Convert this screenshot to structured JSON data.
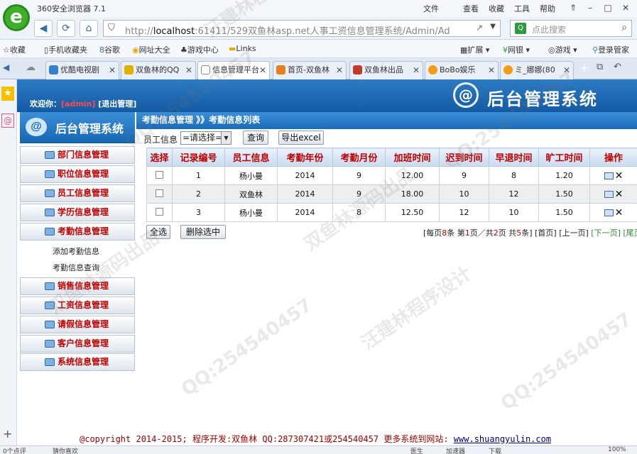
{
  "browser": {
    "title": "360安全浏览器 7.1",
    "menu": [
      "文件",
      "查看",
      "收藏",
      "工具",
      "帮助"
    ],
    "url_host": "localhost",
    "url_rest": ":61411/529双鱼林asp.net人事工资信息管理系统/Admin/Ad",
    "search_placeholder": "点此搜索"
  },
  "favorites": [
    "收藏",
    "手机收藏夹",
    "谷歌",
    "网址大全",
    "游戏中心",
    "Links",
    "扩展",
    "网银",
    "游戏",
    "登录管家"
  ],
  "tabs": [
    {
      "label": "优酷电视剧"
    },
    {
      "label": "双鱼林的QQ"
    },
    {
      "label": "信息管理平台"
    },
    {
      "label": "首页-双鱼林"
    },
    {
      "label": "双鱼林出品"
    },
    {
      "label": "BoBo娱乐"
    },
    {
      "label": "ミ_娜娜(80"
    }
  ],
  "header": {
    "welcome_label": "欢迎你：",
    "user": "[admin]",
    "logout": "[退出管理]",
    "logo": "@",
    "title": "后台管理系统"
  },
  "sidebar": {
    "title": "后台管理系统",
    "items": [
      {
        "label": "部门信息管理"
      },
      {
        "label": "职位信息管理"
      },
      {
        "label": "员工信息管理"
      },
      {
        "label": "学历信息管理"
      },
      {
        "label": "考勤信息管理"
      }
    ],
    "subitems": [
      {
        "label": "添加考勤信息"
      },
      {
        "label": "考勤信息查询"
      }
    ],
    "items2": [
      {
        "label": "销售信息管理"
      },
      {
        "label": "工资信息管理"
      },
      {
        "label": "请假信息管理"
      },
      {
        "label": "客户信息管理"
      },
      {
        "label": "系统信息管理"
      }
    ]
  },
  "content": {
    "breadcrumb": "考勤信息管理 》》考勤信息列表",
    "filter_label": "员工信息",
    "filter_value": "=请选择=",
    "query_button": "查询",
    "export_button": "导出excel",
    "columns": [
      "选择",
      "记录编号",
      "员工信息",
      "考勤年份",
      "考勤月份",
      "加班时间",
      "迟到时间",
      "早退时间",
      "旷工时间",
      "操作"
    ],
    "rows": [
      {
        "id": "1",
        "employee": "杨小曼",
        "year": "2014",
        "month": "9",
        "overtime": "12.00",
        "late": "9",
        "early": "8",
        "absent": "1.20"
      },
      {
        "id": "2",
        "employee": "双鱼林",
        "year": "2014",
        "month": "9",
        "overtime": "18.00",
        "late": "10",
        "early": "12",
        "absent": "1.50"
      },
      {
        "id": "3",
        "employee": "杨小曼",
        "year": "2014",
        "month": "8",
        "overtime": "12.50",
        "late": "12",
        "early": "10",
        "absent": "1.50"
      }
    ],
    "select_all": "全选",
    "delete_selected": "删除选中",
    "pager": {
      "per_page_prefix": "[每页",
      "per_page": "8",
      "per_page_suffix": "条 第",
      "page": "1",
      "page_mid": "页／共",
      "total_pages": "2",
      "total_mid": "页 共",
      "total_records": "5",
      "total_suffix": "条]",
      "first": "[首页]",
      "prev": "[上一页]",
      "next": "[下一页]",
      "last": "[尾页"
    }
  },
  "footer": {
    "copyright": "@copyright 2014-2015; 程序开发:双鱼林  QQ:287307421或254540457  更多系统到网站:",
    "site": "www.shuangyulin.com"
  },
  "statusbar": {
    "left1": "0个点评",
    "left2": "猜你喜欢",
    "r1": "医生",
    "r2": "加速器",
    "r3": "下载",
    "zoom": "100%"
  },
  "watermarks": [
    "QQ:254540457",
    "汪建林程序设计",
    "双鱼林源码出品"
  ]
}
